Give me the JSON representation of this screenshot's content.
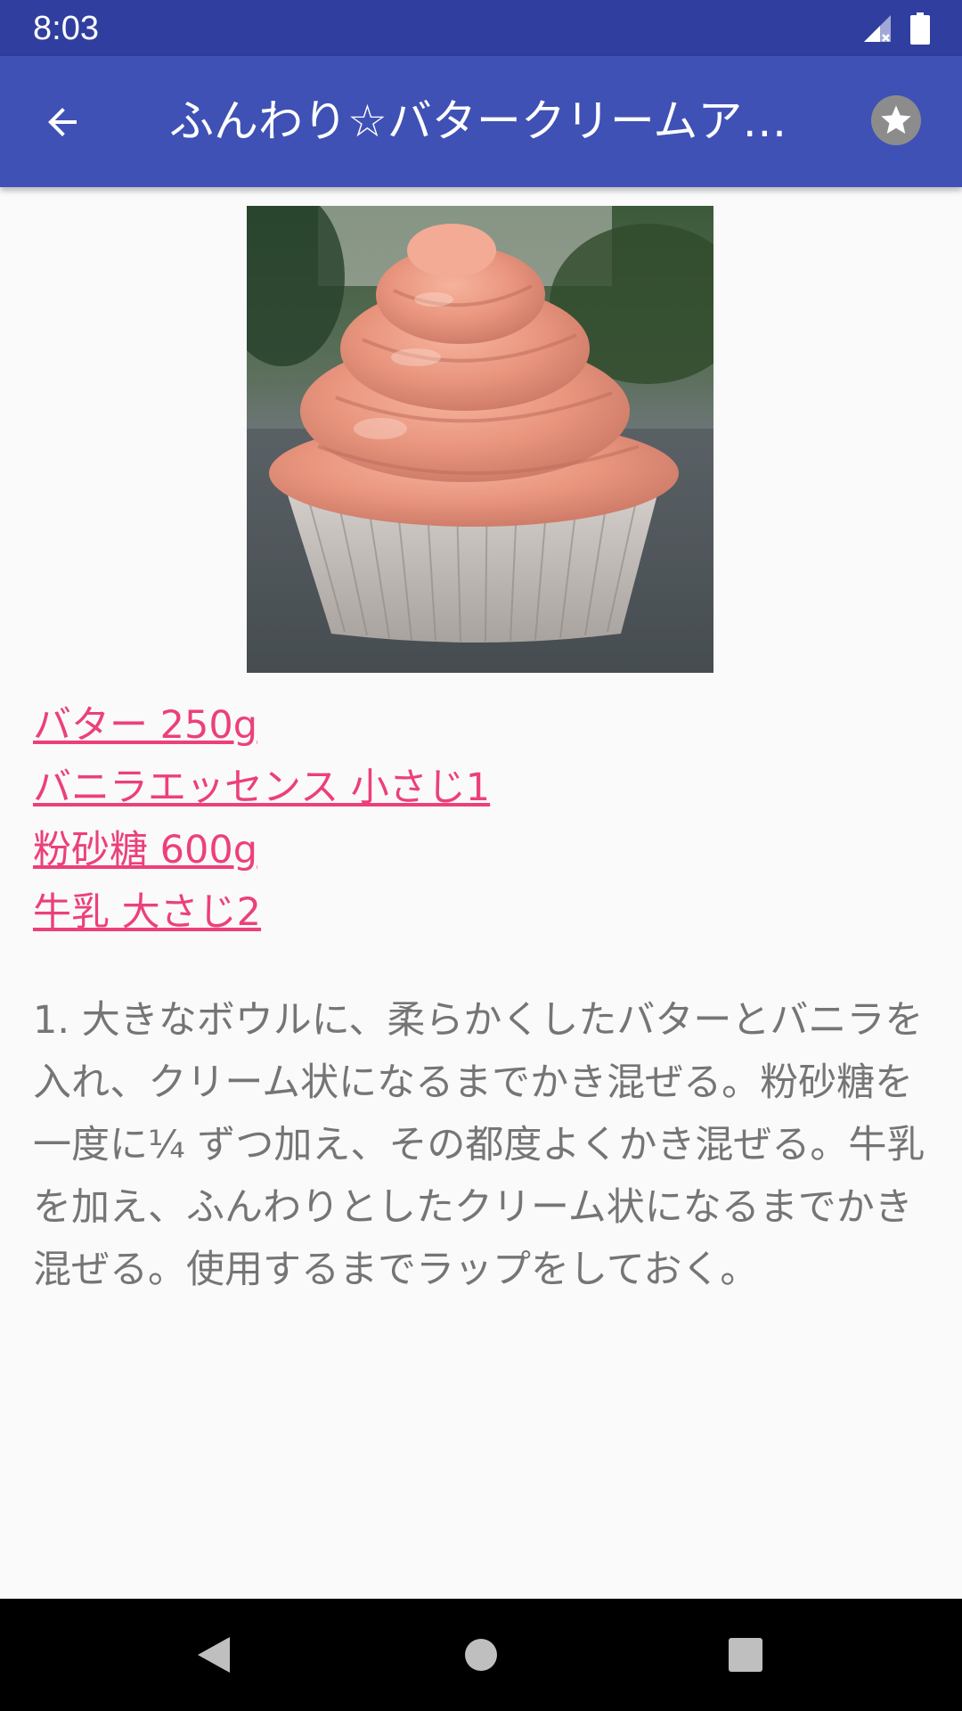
{
  "status_bar": {
    "time": "8:03",
    "icons": [
      "signal-icon",
      "battery-icon"
    ]
  },
  "app_bar": {
    "title": "ふんわり☆バタークリームア…",
    "back_icon": "arrow-back-icon",
    "favorite_icon": "star-icon"
  },
  "recipe": {
    "image": "cupcake-photo",
    "ingredients": [
      "バター 250g",
      "バニラエッセンス 小さじ1",
      "粉砂糖 600g",
      "牛乳 大さじ2"
    ],
    "instructions": "1. 大きなボウルに、柔らかくしたバターとバニラを入れ、クリーム状になるまでかき混ぜる。粉砂糖を 一度に¼ ずつ加え、その都度よくかき混ぜる。牛乳を加え、ふんわりとしたクリーム状になるまでかき混ぜる。使用するまでラップをしておく。"
  },
  "nav_bar": {
    "icons": [
      "nav-back-icon",
      "nav-home-icon",
      "nav-recents-icon"
    ]
  },
  "colors": {
    "status_bar": "#303f9f",
    "app_bar": "#3f51b5",
    "link": "#ec407a",
    "body_text": "#757575",
    "background": "#fafafa"
  }
}
